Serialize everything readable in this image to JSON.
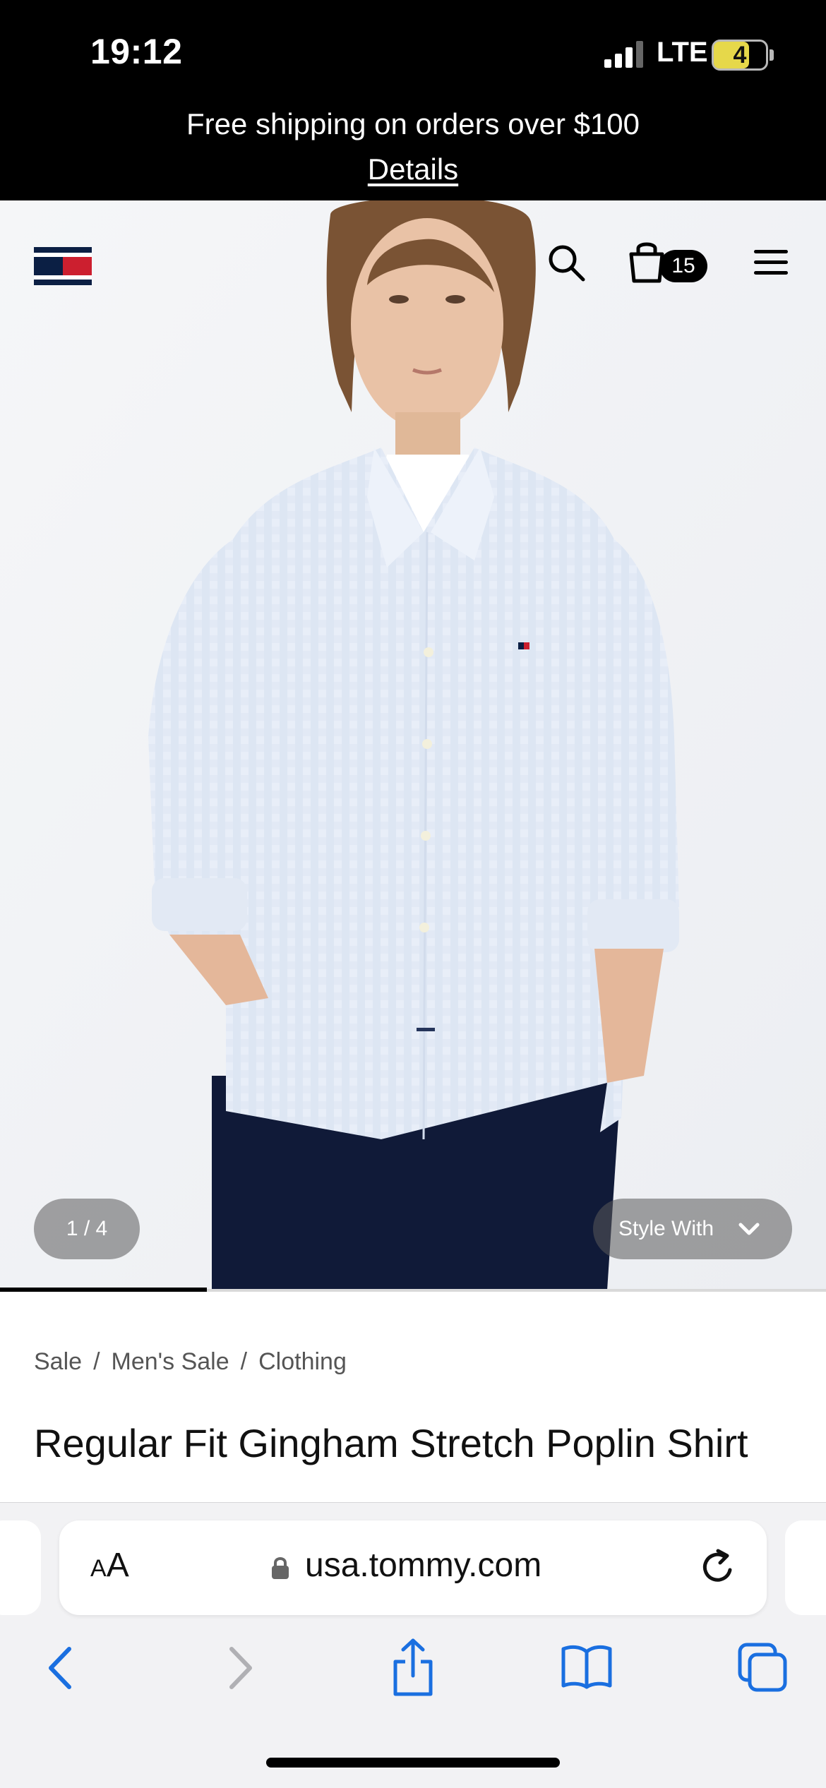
{
  "status_bar": {
    "time": "19:12",
    "network": "LTE",
    "battery_level": "4"
  },
  "promo": {
    "text": "Free shipping on orders over $100",
    "link_label": "Details"
  },
  "header": {
    "cart_count": "15",
    "icons": [
      "tommy-flag-logo",
      "search-icon",
      "shopping-bag-icon",
      "hamburger-menu-icon"
    ]
  },
  "gallery": {
    "counter": "1 / 4",
    "style_with_label": "Style With",
    "current_index": 1,
    "total": 4
  },
  "breadcrumb": {
    "items": [
      "Sale",
      "Men's Sale",
      "Clothing"
    ],
    "separator": "/"
  },
  "product": {
    "title": "Regular Fit Gingham Stretch Poplin Shirt"
  },
  "browser": {
    "aa_label_small": "A",
    "aa_label_large": "A",
    "url": "usa.tommy.com",
    "toolbar_icons": [
      "back-icon",
      "forward-icon",
      "share-icon",
      "bookmarks-icon",
      "tabs-icon"
    ]
  },
  "colors": {
    "accent": "#1a6fe0",
    "brand_navy": "#0b1f44",
    "brand_red": "#cc1f2f"
  }
}
